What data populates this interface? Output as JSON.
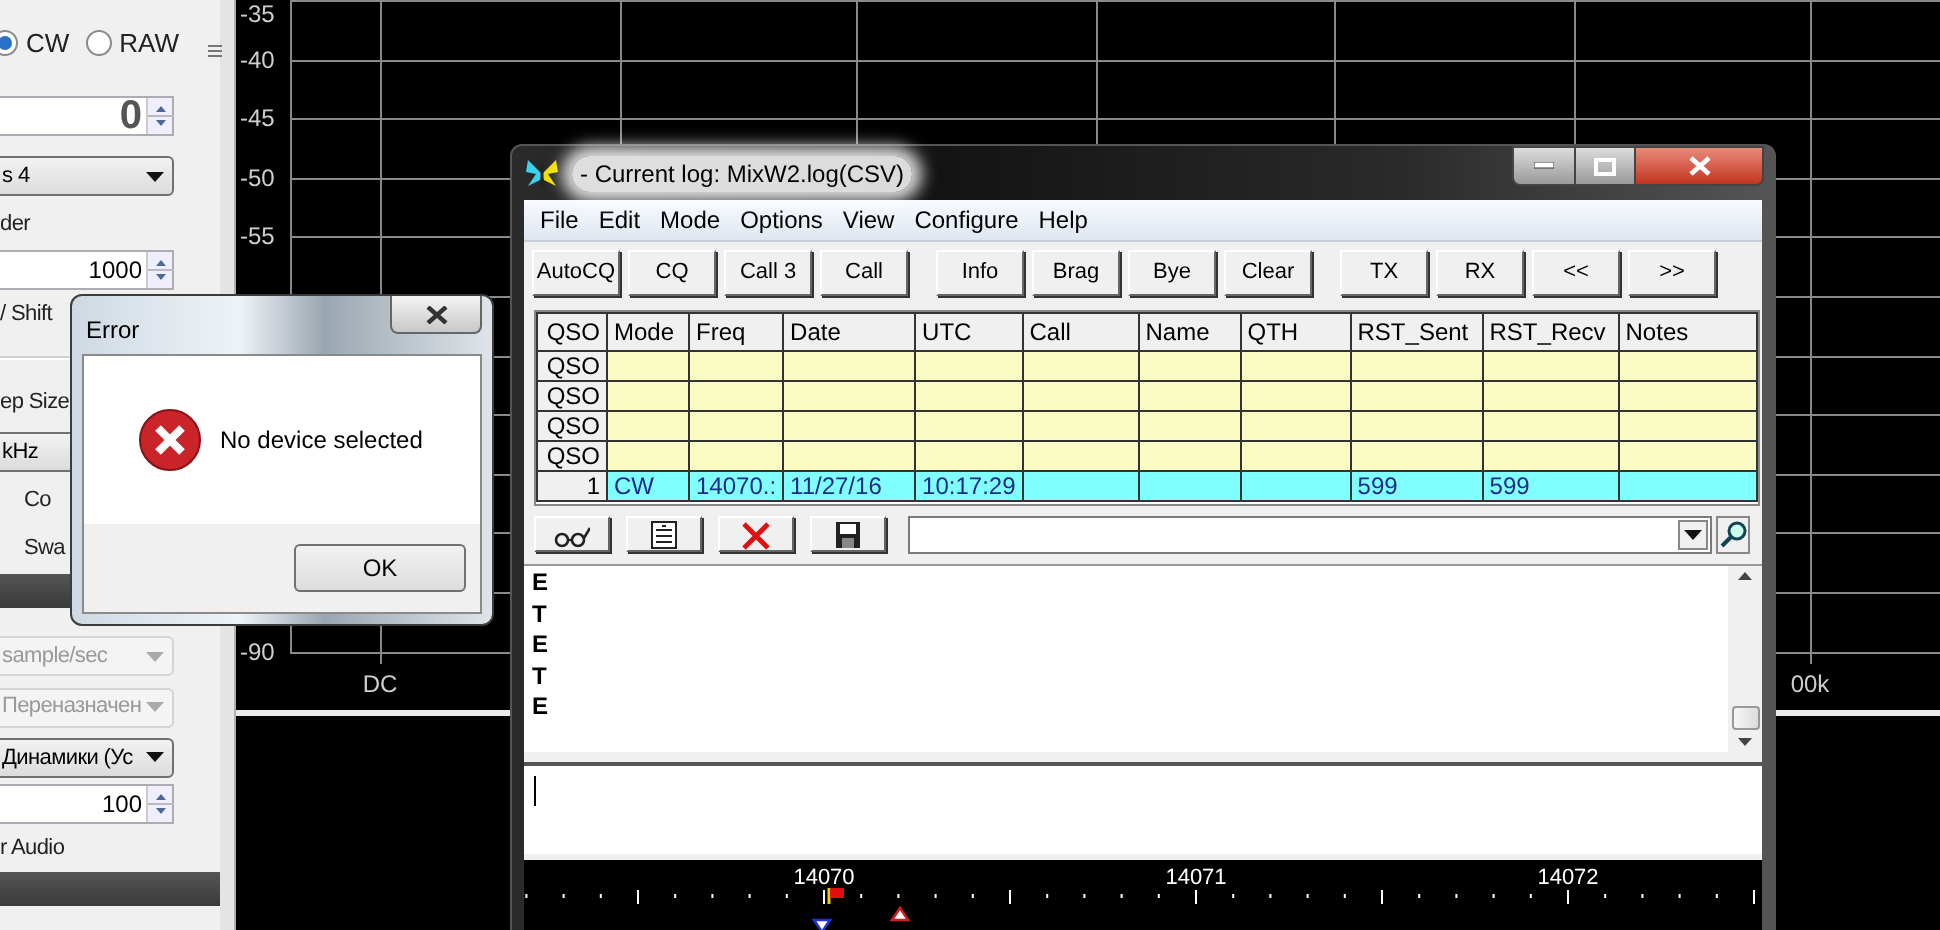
{
  "left_panel": {
    "items": [
      {
        "kind": "radios",
        "options": [
          {
            "label": "CW",
            "selected": true
          },
          {
            "label": "RAW",
            "selected": false
          }
        ]
      },
      {
        "kind": "spin_large",
        "value": "0"
      },
      {
        "kind": "dropdown",
        "value": "s 4",
        "disabled": false
      },
      {
        "kind": "label",
        "text": "der"
      },
      {
        "kind": "spin",
        "value": "1000"
      },
      {
        "kind": "label",
        "text": "/ Shift"
      },
      {
        "kind": "separator"
      },
      {
        "kind": "label",
        "text": "ep Size"
      },
      {
        "kind": "dropdown",
        "value": "kHz",
        "disabled": false
      },
      {
        "kind": "caption",
        "text": "Co"
      },
      {
        "kind": "caption",
        "text": "Swa"
      },
      {
        "kind": "bar"
      },
      {
        "kind": "dropdown",
        "value": "sample/sec",
        "disabled": true
      },
      {
        "kind": "dropdown",
        "value": "Переназначен",
        "disabled": true
      },
      {
        "kind": "dropdown",
        "value": "Динамики (Ус",
        "disabled": false
      },
      {
        "kind": "spin",
        "value": "100"
      },
      {
        "kind": "label",
        "text": "r Audio"
      },
      {
        "kind": "bar"
      }
    ]
  },
  "spectrum": {
    "y_labels": [
      "-35",
      "-40",
      "-45",
      "-50",
      "-55",
      "-90"
    ],
    "x_labels": [
      "DC",
      "00k"
    ]
  },
  "error_dialog": {
    "title": "Error",
    "message": "No device selected",
    "button": "OK"
  },
  "log_window": {
    "title": "- Current log: MixW2.log(CSV)",
    "menu": [
      "File",
      "Edit",
      "Mode",
      "Options",
      "View",
      "Configure",
      "Help"
    ],
    "button_groups": [
      [
        "AutoCQ",
        "CQ",
        "Call 3",
        "Call"
      ],
      [
        "Info",
        "Brag",
        "Bye",
        "Clear"
      ],
      [
        "TX",
        "RX",
        "<<",
        ">>"
      ]
    ],
    "table": {
      "columns": [
        "QSO",
        "Mode",
        "Freq",
        "Date",
        "UTC",
        "Call",
        "Name",
        "QTH",
        "RST_Sent",
        "RST_Recv",
        "Notes"
      ],
      "rows": [
        {
          "selected": false,
          "cells": [
            "QSO"
          ]
        },
        {
          "selected": false,
          "cells": [
            "QSO"
          ]
        },
        {
          "selected": false,
          "cells": [
            "QSO"
          ]
        },
        {
          "selected": false,
          "cells": [
            "QSO"
          ]
        },
        {
          "selected": true,
          "cells": [
            "1",
            "CW",
            "14070.:",
            "11/27/16",
            "10:17:29",
            null,
            null,
            null,
            "599",
            "599",
            null
          ]
        }
      ]
    },
    "receive_lines": [
      "E",
      "T",
      "E",
      "T",
      "E"
    ],
    "scale": {
      "labels": [
        "14070",
        "14071",
        "14072"
      ]
    }
  }
}
